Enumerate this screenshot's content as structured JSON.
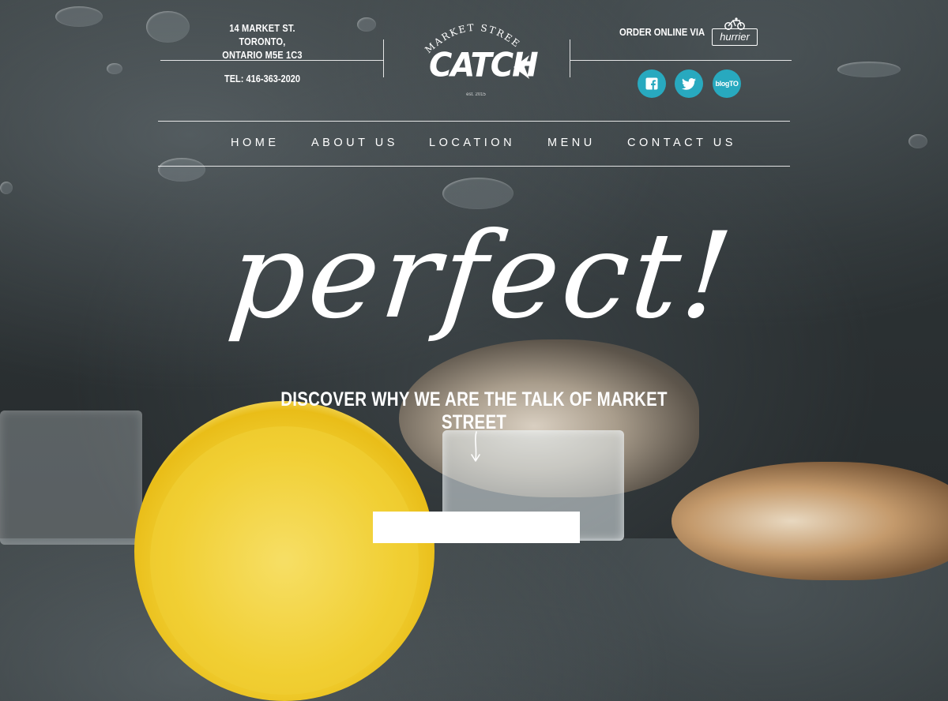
{
  "header": {
    "address_line1": "14 MARKET ST. TORONTO,",
    "address_line2": "ONTARIO M5E 1C3",
    "phone": "TEL: 416-363-2020",
    "order_online": "ORDER ONLINE VIA",
    "order_partner": "hurrier"
  },
  "logo": {
    "arc_text": "MARKET STREET",
    "name": "CATCH",
    "est": "est. 2015"
  },
  "social": [
    {
      "name": "facebook",
      "label": "f"
    },
    {
      "name": "twitter",
      "label": "t"
    },
    {
      "name": "blogto",
      "label": "blogTO"
    }
  ],
  "nav": {
    "items": [
      {
        "label": "HOME"
      },
      {
        "label": "ABOUT US"
      },
      {
        "label": "LOCATION"
      },
      {
        "label": "MENU"
      },
      {
        "label": "CONTACT US"
      }
    ]
  },
  "hero": {
    "headline": "perfect!",
    "tagline": "DISCOVER WHY WE ARE THE TALK OF MARKET STREET"
  },
  "colors": {
    "accent": "#28a9bf",
    "background": "#2c3234",
    "text": "#ffffff"
  }
}
